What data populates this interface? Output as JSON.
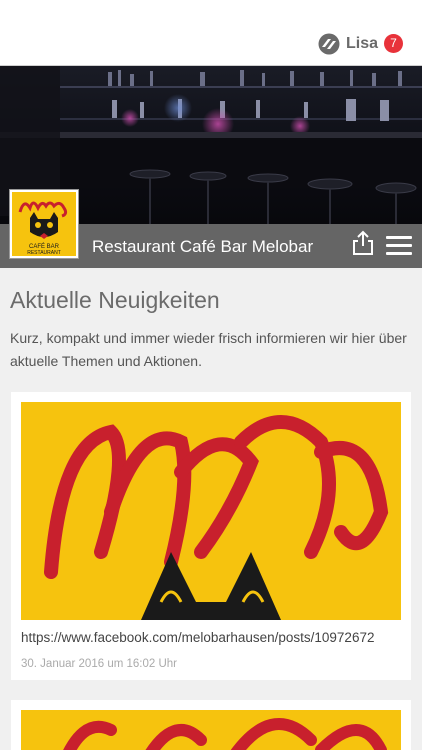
{
  "topbar": {
    "user_name": "Lisa",
    "notification_count": "7",
    "icon": "brand-logo-icon"
  },
  "header": {
    "title": "Restaurant Café Bar Melobar",
    "logo_icon": "melo-logo-icon",
    "share_icon": "share-icon",
    "menu_icon": "hamburger-menu-icon"
  },
  "news": {
    "heading": "Aktuelle Neuigkeiten",
    "description": "Kurz, kompakt und immer wieder frisch informieren wir hier über aktuelle Themen und Aktionen.",
    "items": [
      {
        "link": "https://www.facebook.com/melobarhausen/posts/10972672",
        "date": "30. Januar 2016 um 16:02 Uhr"
      },
      {
        "link": "",
        "date": ""
      }
    ]
  },
  "colors": {
    "badge": "#e8323a",
    "logo_yellow": "#f6c30e",
    "titlebar": "#6e6e6e"
  }
}
